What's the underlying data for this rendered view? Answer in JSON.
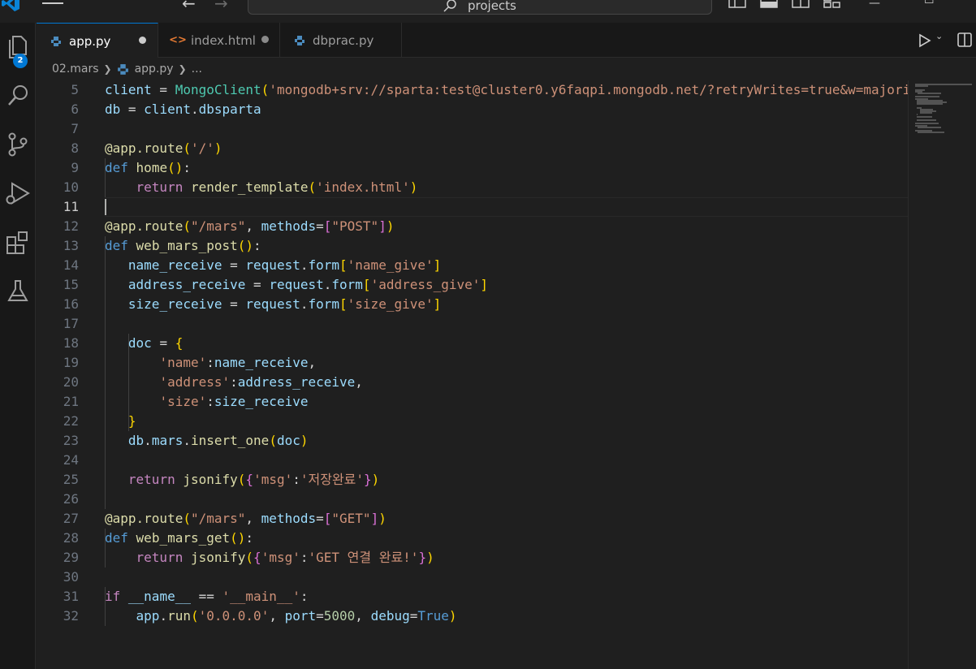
{
  "titlebar": {
    "search_text": "projects"
  },
  "activity": {
    "explorer_badge": "2",
    "icons": [
      "files-icon",
      "search-icon",
      "source-control-icon",
      "run-debug-icon",
      "extensions-icon",
      "testing-icon"
    ]
  },
  "tabs": [
    {
      "label": "app.py",
      "icon": "python-icon",
      "active": true,
      "modified": true
    },
    {
      "label": "index.html",
      "icon": "html-icon",
      "active": false,
      "modified": true
    },
    {
      "label": "dbprac.py",
      "icon": "python-icon",
      "active": false,
      "modified": false
    }
  ],
  "breadcrumb": {
    "folder": "02.mars",
    "file": "app.py",
    "symbol": "..."
  },
  "editor": {
    "current_line": 11,
    "lines": [
      {
        "n": "5",
        "tokens": [
          [
            "v",
            "client"
          ],
          [
            "d",
            " = "
          ],
          [
            "t",
            "MongoClient"
          ],
          [
            "p1",
            "("
          ],
          [
            "s",
            "'mongodb+srv://sparta:test@cluster0.y6faqpi.mongodb.net/?retryWrites=true&w=majori"
          ]
        ]
      },
      {
        "n": "6",
        "tokens": [
          [
            "v",
            "db"
          ],
          [
            "d",
            " = "
          ],
          [
            "v",
            "client"
          ],
          [
            "d",
            "."
          ],
          [
            "v",
            "dbsparta"
          ]
        ]
      },
      {
        "n": "7",
        "tokens": []
      },
      {
        "n": "8",
        "tokens": [
          [
            "f",
            "@app.route"
          ],
          [
            "p1",
            "("
          ],
          [
            "s",
            "'/'"
          ],
          [
            "p1",
            ")"
          ]
        ]
      },
      {
        "n": "9",
        "tokens": [
          [
            "k",
            "def"
          ],
          [
            "d",
            " "
          ],
          [
            "f",
            "home"
          ],
          [
            "p1",
            "()"
          ],
          [
            "d",
            ":"
          ]
        ]
      },
      {
        "n": "10",
        "tokens": [
          [
            "d",
            "    "
          ],
          [
            "kc",
            "return"
          ],
          [
            "d",
            " "
          ],
          [
            "f",
            "render_template"
          ],
          [
            "p1",
            "("
          ],
          [
            "s",
            "'index.html'"
          ],
          [
            "p1",
            ")"
          ]
        ]
      },
      {
        "n": "11",
        "tokens": []
      },
      {
        "n": "12",
        "tokens": [
          [
            "f",
            "@app.route"
          ],
          [
            "p1",
            "("
          ],
          [
            "s",
            "\"/mars\""
          ],
          [
            "d",
            ", "
          ],
          [
            "v",
            "methods"
          ],
          [
            "d",
            "="
          ],
          [
            "p2",
            "["
          ],
          [
            "s",
            "\"POST\""
          ],
          [
            "p2",
            "]"
          ],
          [
            "p1",
            ")"
          ]
        ]
      },
      {
        "n": "13",
        "tokens": [
          [
            "k",
            "def"
          ],
          [
            "d",
            " "
          ],
          [
            "f",
            "web_mars_post"
          ],
          [
            "p1",
            "()"
          ],
          [
            "d",
            ":"
          ]
        ]
      },
      {
        "n": "14",
        "tokens": [
          [
            "d",
            "   "
          ],
          [
            "v",
            "name_receive"
          ],
          [
            "d",
            " = "
          ],
          [
            "v",
            "request"
          ],
          [
            "d",
            "."
          ],
          [
            "v",
            "form"
          ],
          [
            "p1",
            "["
          ],
          [
            "s",
            "'name_give'"
          ],
          [
            "p1",
            "]"
          ]
        ]
      },
      {
        "n": "15",
        "tokens": [
          [
            "d",
            "   "
          ],
          [
            "v",
            "address_receive"
          ],
          [
            "d",
            " = "
          ],
          [
            "v",
            "request"
          ],
          [
            "d",
            "."
          ],
          [
            "v",
            "form"
          ],
          [
            "p1",
            "["
          ],
          [
            "s",
            "'address_give'"
          ],
          [
            "p1",
            "]"
          ]
        ]
      },
      {
        "n": "16",
        "tokens": [
          [
            "d",
            "   "
          ],
          [
            "v",
            "size_receive"
          ],
          [
            "d",
            " = "
          ],
          [
            "v",
            "request"
          ],
          [
            "d",
            "."
          ],
          [
            "v",
            "form"
          ],
          [
            "p1",
            "["
          ],
          [
            "s",
            "'size_give'"
          ],
          [
            "p1",
            "]"
          ]
        ]
      },
      {
        "n": "17",
        "tokens": []
      },
      {
        "n": "18",
        "tokens": [
          [
            "d",
            "   "
          ],
          [
            "v",
            "doc"
          ],
          [
            "d",
            " = "
          ],
          [
            "p1",
            "{"
          ]
        ]
      },
      {
        "n": "19",
        "tokens": [
          [
            "d",
            "       "
          ],
          [
            "s",
            "'name'"
          ],
          [
            "d",
            ":"
          ],
          [
            "v",
            "name_receive"
          ],
          [
            "d",
            ","
          ]
        ]
      },
      {
        "n": "20",
        "tokens": [
          [
            "d",
            "       "
          ],
          [
            "s",
            "'address'"
          ],
          [
            "d",
            ":"
          ],
          [
            "v",
            "address_receive"
          ],
          [
            "d",
            ","
          ]
        ]
      },
      {
        "n": "21",
        "tokens": [
          [
            "d",
            "       "
          ],
          [
            "s",
            "'size'"
          ],
          [
            "d",
            ":"
          ],
          [
            "v",
            "size_receive"
          ]
        ]
      },
      {
        "n": "22",
        "tokens": [
          [
            "d",
            "   "
          ],
          [
            "p1",
            "}"
          ]
        ]
      },
      {
        "n": "23",
        "tokens": [
          [
            "d",
            "   "
          ],
          [
            "v",
            "db"
          ],
          [
            "d",
            "."
          ],
          [
            "v",
            "mars"
          ],
          [
            "d",
            "."
          ],
          [
            "f",
            "insert_one"
          ],
          [
            "p1",
            "("
          ],
          [
            "v",
            "doc"
          ],
          [
            "p1",
            ")"
          ]
        ]
      },
      {
        "n": "24",
        "tokens": []
      },
      {
        "n": "25",
        "tokens": [
          [
            "d",
            "   "
          ],
          [
            "kc",
            "return"
          ],
          [
            "d",
            " "
          ],
          [
            "f",
            "jsonify"
          ],
          [
            "p1",
            "("
          ],
          [
            "p2",
            "{"
          ],
          [
            "s",
            "'msg'"
          ],
          [
            "d",
            ":"
          ],
          [
            "s",
            "'저장완료'"
          ],
          [
            "p2",
            "}"
          ],
          [
            "p1",
            ")"
          ]
        ]
      },
      {
        "n": "26",
        "tokens": []
      },
      {
        "n": "27",
        "tokens": [
          [
            "f",
            "@app.route"
          ],
          [
            "p1",
            "("
          ],
          [
            "s",
            "\"/mars\""
          ],
          [
            "d",
            ", "
          ],
          [
            "v",
            "methods"
          ],
          [
            "d",
            "="
          ],
          [
            "p2",
            "["
          ],
          [
            "s",
            "\"GET\""
          ],
          [
            "p2",
            "]"
          ],
          [
            "p1",
            ")"
          ]
        ]
      },
      {
        "n": "28",
        "tokens": [
          [
            "k",
            "def"
          ],
          [
            "d",
            " "
          ],
          [
            "f",
            "web_mars_get"
          ],
          [
            "p1",
            "()"
          ],
          [
            "d",
            ":"
          ]
        ]
      },
      {
        "n": "29",
        "tokens": [
          [
            "d",
            "    "
          ],
          [
            "kc",
            "return"
          ],
          [
            "d",
            " "
          ],
          [
            "f",
            "jsonify"
          ],
          [
            "p1",
            "("
          ],
          [
            "p2",
            "{"
          ],
          [
            "s",
            "'msg'"
          ],
          [
            "d",
            ":"
          ],
          [
            "s",
            "'GET 연결 완료!'"
          ],
          [
            "p2",
            "}"
          ],
          [
            "p1",
            ")"
          ]
        ]
      },
      {
        "n": "30",
        "tokens": []
      },
      {
        "n": "31",
        "tokens": [
          [
            "kc",
            "if"
          ],
          [
            "d",
            " "
          ],
          [
            "v",
            "__name__"
          ],
          [
            "d",
            " == "
          ],
          [
            "s",
            "'__main__'"
          ],
          [
            "d",
            ":"
          ]
        ]
      },
      {
        "n": "32",
        "tokens": [
          [
            "d",
            "    "
          ],
          [
            "v",
            "app"
          ],
          [
            "d",
            "."
          ],
          [
            "f",
            "run"
          ],
          [
            "p1",
            "("
          ],
          [
            "s",
            "'0.0.0.0'"
          ],
          [
            "d",
            ", "
          ],
          [
            "v",
            "port"
          ],
          [
            "d",
            "="
          ],
          [
            "n",
            "5000"
          ],
          [
            "d",
            ", "
          ],
          [
            "v",
            "debug"
          ],
          [
            "d",
            "="
          ],
          [
            "k",
            "True"
          ],
          [
            "p1",
            ")"
          ]
        ]
      }
    ]
  }
}
